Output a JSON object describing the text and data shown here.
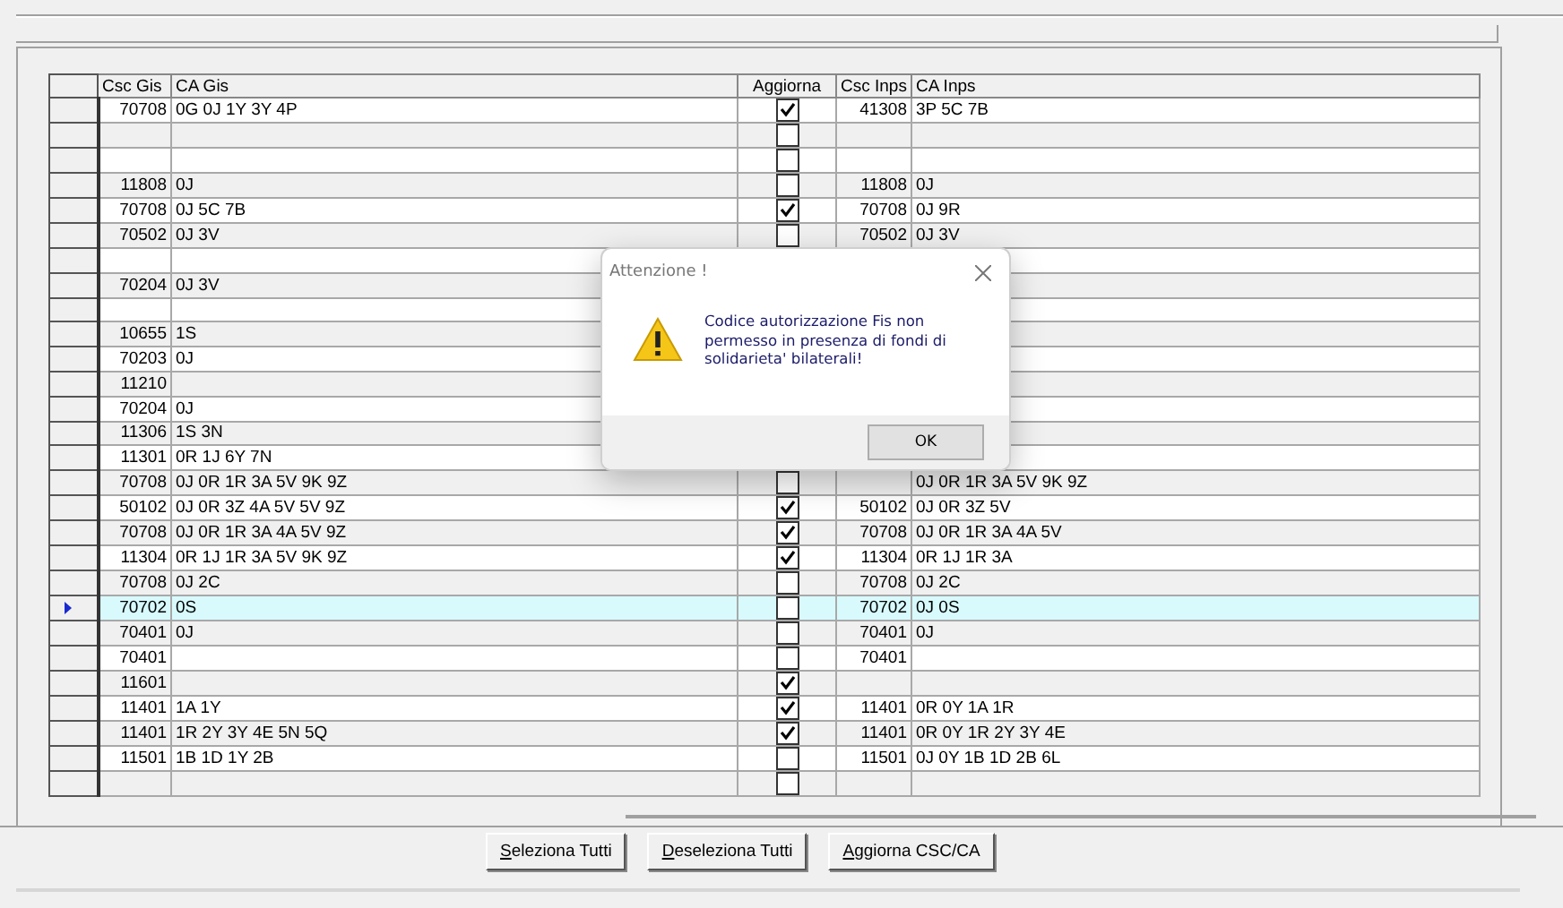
{
  "grid": {
    "columns": [
      "Csc Gis",
      "CA Gis",
      "Aggiorna",
      "Csc Inps",
      "CA Inps"
    ],
    "rows": [
      {
        "csc_gis": "70708",
        "ca_gis": "0G 0J 1Y 3Y 4P",
        "checked": true,
        "csc_inps": "41308",
        "ca_inps": "3P 5C 7B",
        "selected": false
      },
      {
        "checked": false,
        "selected": false
      },
      {
        "checked": false,
        "selected": false
      },
      {
        "csc_gis": "11808",
        "ca_gis": "0J",
        "checked": false,
        "csc_inps": "11808",
        "ca_inps": "0J",
        "selected": false
      },
      {
        "csc_gis": "70708",
        "ca_gis": "0J 5C 7B",
        "checked": true,
        "csc_inps": "70708",
        "ca_inps": "0J 9R",
        "selected": false
      },
      {
        "csc_gis": "70502",
        "ca_gis": "0J 3V",
        "checked": false,
        "csc_inps": "70502",
        "ca_inps": "0J 3V",
        "selected": false
      },
      {
        "selected": false
      },
      {
        "csc_gis": "70204",
        "ca_gis": "0J 3V",
        "selected": false
      },
      {
        "selected": false
      },
      {
        "csc_gis": "10655",
        "ca_gis": "1S",
        "selected": false
      },
      {
        "csc_gis": "70203",
        "ca_gis": "0J",
        "selected": false
      },
      {
        "csc_gis": "11210",
        "selected": false
      },
      {
        "csc_gis": "70204",
        "ca_gis": "0J",
        "selected": false
      },
      {
        "csc_gis": "11306",
        "ca_gis": "1S 3N",
        "selected": false
      },
      {
        "csc_gis": "11301",
        "ca_gis": "0R 1J 6Y 7N",
        "selected": false
      },
      {
        "csc_gis": "70708",
        "ca_gis": "0J 0R 1R 3A 5V 9K 9Z",
        "checked": false,
        "ca_inps": "0J 0R 1R 3A 5V 9K 9Z",
        "selected": false
      },
      {
        "csc_gis": "50102",
        "ca_gis": "0J 0R 3Z 4A 5V 5V 9Z",
        "checked": true,
        "csc_inps": "50102",
        "ca_inps": "0J 0R 3Z 5V",
        "selected": false
      },
      {
        "csc_gis": "70708",
        "ca_gis": "0J 0R 1R 3A 4A 5V 9Z",
        "checked": true,
        "csc_inps": "70708",
        "ca_inps": "0J 0R 1R 3A 4A 5V",
        "selected": false
      },
      {
        "csc_gis": "11304",
        "ca_gis": "0R 1J 1R 3A 5V 9K 9Z",
        "checked": true,
        "csc_inps": "11304",
        "ca_inps": "0R 1J 1R 3A",
        "selected": false
      },
      {
        "csc_gis": "70708",
        "ca_gis": "0J 2C",
        "checked": false,
        "csc_inps": "70708",
        "ca_inps": "0J 2C",
        "selected": false
      },
      {
        "csc_gis": "70702",
        "ca_gis": "0S",
        "checked": false,
        "csc_inps": "70702",
        "ca_inps": "0J 0S",
        "selected": true
      },
      {
        "csc_gis": "70401",
        "ca_gis": "0J",
        "checked": false,
        "csc_inps": "70401",
        "ca_inps": "0J",
        "selected": false
      },
      {
        "csc_gis": "70401",
        "checked": false,
        "csc_inps": "70401",
        "selected": false
      },
      {
        "csc_gis": "11601",
        "checked": true,
        "selected": false
      },
      {
        "csc_gis": "11401",
        "ca_gis": "1A 1Y",
        "checked": true,
        "csc_inps": "11401",
        "ca_inps": "0R 0Y 1A 1R",
        "selected": false
      },
      {
        "csc_gis": "11401",
        "ca_gis": "1R 2Y 3Y 4E 5N 5Q",
        "checked": true,
        "csc_inps": "11401",
        "ca_inps": "0R 0Y 1R 2Y 3Y 4E",
        "selected": false
      },
      {
        "csc_gis": "11501",
        "ca_gis": "1B 1D 1Y 2B",
        "checked": false,
        "csc_inps": "11501",
        "ca_inps": "0J 0Y 1B 1D 2B 6L",
        "selected": false
      },
      {
        "checked": false,
        "selected": false
      }
    ]
  },
  "buttons": [
    "Seleziona Tutti",
    "Deseleziona Tutti",
    "Aggiorna CSC/CA"
  ],
  "dialog": {
    "title": "Attenzione !",
    "message": "Codice autorizzazione Fis non permesso in presenza di fondi di solidarieta' bilaterali!",
    "button": "OK"
  }
}
